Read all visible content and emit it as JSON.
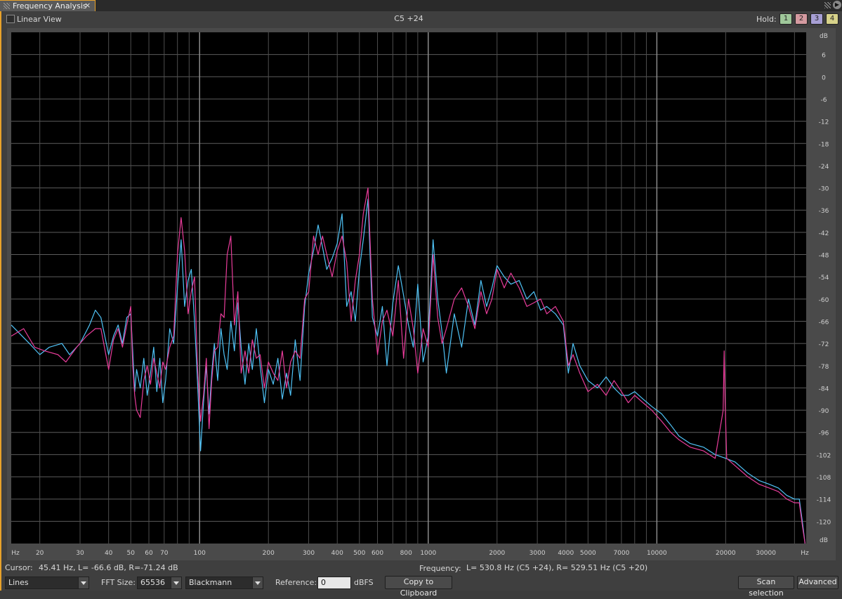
{
  "window": {
    "tab_title": "Frequency Analysis",
    "tab_close": "×"
  },
  "toolbar": {
    "linear_view_label": "Linear View",
    "linear_view_checked": false,
    "note_readout": "C5 +24",
    "hold_label": "Hold:",
    "hold_buttons": [
      {
        "label": "1",
        "color": "#9fc79a"
      },
      {
        "label": "2",
        "color": "#d49aa0"
      },
      {
        "label": "3",
        "color": "#a79fd4"
      },
      {
        "label": "4",
        "color": "#d7d28a"
      }
    ]
  },
  "chart_data": {
    "type": "line",
    "x_scale": "log",
    "xlim": [
      15,
      45000
    ],
    "ylim": [
      -126,
      12
    ],
    "x_unit": "Hz",
    "y_unit": "dB",
    "grid": true,
    "x_tick_labels": [
      {
        "f": 20,
        "label": "20"
      },
      {
        "f": 30,
        "label": "30"
      },
      {
        "f": 40,
        "label": "40"
      },
      {
        "f": 50,
        "label": "50"
      },
      {
        "f": 60,
        "label": "60"
      },
      {
        "f": 70,
        "label": "70"
      },
      {
        "f": 100,
        "label": "100"
      },
      {
        "f": 200,
        "label": "200"
      },
      {
        "f": 300,
        "label": "300"
      },
      {
        "f": 400,
        "label": "400"
      },
      {
        "f": 500,
        "label": "500"
      },
      {
        "f": 600,
        "label": "600"
      },
      {
        "f": 800,
        "label": "800"
      },
      {
        "f": 1000,
        "label": "1000"
      },
      {
        "f": 2000,
        "label": "2000"
      },
      {
        "f": 3000,
        "label": "3000"
      },
      {
        "f": 4000,
        "label": "4000"
      },
      {
        "f": 5000,
        "label": "5000"
      },
      {
        "f": 7000,
        "label": "7000"
      },
      {
        "f": 10000,
        "label": "10000"
      },
      {
        "f": 20000,
        "label": "20000"
      },
      {
        "f": 30000,
        "label": "30000"
      }
    ],
    "y_ticks": [
      6,
      0,
      -6,
      -12,
      -18,
      -24,
      -30,
      -36,
      -42,
      -48,
      -54,
      -60,
      -66,
      -72,
      -78,
      -84,
      -90,
      -96,
      -102,
      -108,
      -114,
      -120
    ],
    "series": [
      {
        "color": "#4fc3f7",
        "points": [
          [
            15,
            -67
          ],
          [
            18,
            -72
          ],
          [
            20,
            -75
          ],
          [
            22,
            -73
          ],
          [
            25,
            -72
          ],
          [
            27,
            -75
          ],
          [
            30,
            -72
          ],
          [
            33,
            -67
          ],
          [
            35,
            -63
          ],
          [
            37,
            -65
          ],
          [
            40,
            -75
          ],
          [
            42,
            -70
          ],
          [
            44,
            -67
          ],
          [
            46,
            -72
          ],
          [
            48,
            -65
          ],
          [
            50,
            -64
          ],
          [
            51,
            -74
          ],
          [
            52,
            -85
          ],
          [
            53,
            -79
          ],
          [
            55,
            -84
          ],
          [
            57,
            -76
          ],
          [
            59,
            -86
          ],
          [
            61,
            -80
          ],
          [
            63,
            -73
          ],
          [
            65,
            -85
          ],
          [
            67,
            -76
          ],
          [
            69,
            -88
          ],
          [
            71,
            -82
          ],
          [
            74,
            -68
          ],
          [
            77,
            -72
          ],
          [
            80,
            -57
          ],
          [
            83,
            -44
          ],
          [
            86,
            -62
          ],
          [
            89,
            -55
          ],
          [
            92,
            -52
          ],
          [
            95,
            -66
          ],
          [
            98,
            -83
          ],
          [
            101,
            -101
          ],
          [
            104,
            -88
          ],
          [
            107,
            -78
          ],
          [
            110,
            -91
          ],
          [
            113,
            -80
          ],
          [
            116,
            -72
          ],
          [
            120,
            -82
          ],
          [
            124,
            -68
          ],
          [
            128,
            -75
          ],
          [
            132,
            -79
          ],
          [
            137,
            -66
          ],
          [
            142,
            -74
          ],
          [
            147,
            -61
          ],
          [
            152,
            -73
          ],
          [
            158,
            -83
          ],
          [
            164,
            -72
          ],
          [
            170,
            -79
          ],
          [
            177,
            -68
          ],
          [
            184,
            -78
          ],
          [
            192,
            -88
          ],
          [
            200,
            -79
          ],
          [
            210,
            -83
          ],
          [
            220,
            -76
          ],
          [
            230,
            -87
          ],
          [
            240,
            -80
          ],
          [
            250,
            -86
          ],
          [
            262,
            -71
          ],
          [
            275,
            -82
          ],
          [
            288,
            -62
          ],
          [
            300,
            -53
          ],
          [
            315,
            -47
          ],
          [
            330,
            -40
          ],
          [
            345,
            -46
          ],
          [
            360,
            -52
          ],
          [
            380,
            -49
          ],
          [
            400,
            -45
          ],
          [
            420,
            -37
          ],
          [
            440,
            -62
          ],
          [
            460,
            -58
          ],
          [
            480,
            -66
          ],
          [
            500,
            -52
          ],
          [
            520,
            -44
          ],
          [
            545,
            -33
          ],
          [
            570,
            -65
          ],
          [
            600,
            -70
          ],
          [
            630,
            -62
          ],
          [
            660,
            -78
          ],
          [
            700,
            -61
          ],
          [
            740,
            -51
          ],
          [
            780,
            -59
          ],
          [
            820,
            -67
          ],
          [
            860,
            -73
          ],
          [
            900,
            -56
          ],
          [
            950,
            -77
          ],
          [
            1000,
            -70
          ],
          [
            1050,
            -44
          ],
          [
            1100,
            -60
          ],
          [
            1150,
            -69
          ],
          [
            1200,
            -80
          ],
          [
            1300,
            -64
          ],
          [
            1400,
            -73
          ],
          [
            1500,
            -60
          ],
          [
            1600,
            -67
          ],
          [
            1700,
            -55
          ],
          [
            1800,
            -62
          ],
          [
            1900,
            -57
          ],
          [
            2000,
            -51
          ],
          [
            2150,
            -54
          ],
          [
            2300,
            -56
          ],
          [
            2500,
            -55
          ],
          [
            2700,
            -60
          ],
          [
            2900,
            -58
          ],
          [
            3100,
            -63
          ],
          [
            3300,
            -62
          ],
          [
            3600,
            -64
          ],
          [
            3900,
            -67
          ],
          [
            4100,
            -80
          ],
          [
            4300,
            -72
          ],
          [
            4600,
            -78
          ],
          [
            5000,
            -82
          ],
          [
            5500,
            -84
          ],
          [
            6000,
            -81
          ],
          [
            6500,
            -84
          ],
          [
            7000,
            -86
          ],
          [
            7500,
            -86
          ],
          [
            8000,
            -85
          ],
          [
            8700,
            -87
          ],
          [
            9500,
            -89
          ],
          [
            10500,
            -91
          ],
          [
            11500,
            -94
          ],
          [
            12500,
            -97
          ],
          [
            14000,
            -99
          ],
          [
            16000,
            -100
          ],
          [
            18000,
            -102
          ],
          [
            20000,
            -103
          ],
          [
            22000,
            -104
          ],
          [
            25000,
            -107
          ],
          [
            28000,
            -109
          ],
          [
            31000,
            -110
          ],
          [
            34000,
            -111
          ],
          [
            37000,
            -113
          ],
          [
            40000,
            -114
          ],
          [
            42000,
            -114
          ],
          [
            43500,
            -121
          ],
          [
            44500,
            -126
          ]
        ]
      },
      {
        "color": "#e83c9a",
        "points": [
          [
            15,
            -70
          ],
          [
            17,
            -68
          ],
          [
            19,
            -73
          ],
          [
            21,
            -74
          ],
          [
            24,
            -75
          ],
          [
            26,
            -77
          ],
          [
            29,
            -73
          ],
          [
            32,
            -70
          ],
          [
            35,
            -68
          ],
          [
            37,
            -68
          ],
          [
            40,
            -79
          ],
          [
            42,
            -71
          ],
          [
            44,
            -68
          ],
          [
            46,
            -73
          ],
          [
            48,
            -67
          ],
          [
            50,
            -62
          ],
          [
            51,
            -78
          ],
          [
            52,
            -86
          ],
          [
            53,
            -90
          ],
          [
            55,
            -92
          ],
          [
            57,
            -82
          ],
          [
            59,
            -78
          ],
          [
            61,
            -83
          ],
          [
            63,
            -76
          ],
          [
            65,
            -80
          ],
          [
            67,
            -84
          ],
          [
            69,
            -77
          ],
          [
            71,
            -79
          ],
          [
            74,
            -73
          ],
          [
            77,
            -70
          ],
          [
            80,
            -48
          ],
          [
            83,
            -38
          ],
          [
            86,
            -47
          ],
          [
            89,
            -64
          ],
          [
            92,
            -58
          ],
          [
            95,
            -54
          ],
          [
            98,
            -79
          ],
          [
            101,
            -93
          ],
          [
            104,
            -86
          ],
          [
            107,
            -76
          ],
          [
            110,
            -95
          ],
          [
            113,
            -82
          ],
          [
            116,
            -74
          ],
          [
            120,
            -73
          ],
          [
            124,
            -64
          ],
          [
            128,
            -65
          ],
          [
            132,
            -48
          ],
          [
            137,
            -43
          ],
          [
            142,
            -67
          ],
          [
            147,
            -58
          ],
          [
            152,
            -80
          ],
          [
            158,
            -74
          ],
          [
            164,
            -80
          ],
          [
            170,
            -71
          ],
          [
            177,
            -76
          ],
          [
            184,
            -75
          ],
          [
            192,
            -84
          ],
          [
            200,
            -77
          ],
          [
            210,
            -80
          ],
          [
            220,
            -82
          ],
          [
            230,
            -74
          ],
          [
            240,
            -84
          ],
          [
            250,
            -77
          ],
          [
            262,
            -74
          ],
          [
            275,
            -76
          ],
          [
            288,
            -60
          ],
          [
            300,
            -58
          ],
          [
            315,
            -43
          ],
          [
            330,
            -48
          ],
          [
            345,
            -43
          ],
          [
            360,
            -48
          ],
          [
            380,
            -54
          ],
          [
            400,
            -47
          ],
          [
            420,
            -43
          ],
          [
            440,
            -50
          ],
          [
            460,
            -66
          ],
          [
            480,
            -55
          ],
          [
            500,
            -48
          ],
          [
            520,
            -37
          ],
          [
            545,
            -30
          ],
          [
            570,
            -60
          ],
          [
            600,
            -75
          ],
          [
            630,
            -66
          ],
          [
            660,
            -63
          ],
          [
            700,
            -70
          ],
          [
            740,
            -55
          ],
          [
            780,
            -76
          ],
          [
            820,
            -60
          ],
          [
            860,
            -68
          ],
          [
            900,
            -80
          ],
          [
            950,
            -68
          ],
          [
            1000,
            -73
          ],
          [
            1050,
            -48
          ],
          [
            1100,
            -65
          ],
          [
            1150,
            -72
          ],
          [
            1200,
            -68
          ],
          [
            1300,
            -60
          ],
          [
            1400,
            -57
          ],
          [
            1500,
            -62
          ],
          [
            1600,
            -68
          ],
          [
            1700,
            -58
          ],
          [
            1800,
            -64
          ],
          [
            1900,
            -60
          ],
          [
            2000,
            -52
          ],
          [
            2150,
            -57
          ],
          [
            2300,
            -53
          ],
          [
            2500,
            -57
          ],
          [
            2700,
            -62
          ],
          [
            2900,
            -61
          ],
          [
            3100,
            -60
          ],
          [
            3300,
            -64
          ],
          [
            3600,
            -62
          ],
          [
            3900,
            -66
          ],
          [
            4100,
            -78
          ],
          [
            4300,
            -75
          ],
          [
            4600,
            -80
          ],
          [
            5000,
            -85
          ],
          [
            5500,
            -83
          ],
          [
            6000,
            -86
          ],
          [
            6500,
            -82
          ],
          [
            7000,
            -85
          ],
          [
            7500,
            -88
          ],
          [
            8000,
            -86
          ],
          [
            8700,
            -88
          ],
          [
            9500,
            -90
          ],
          [
            10500,
            -93
          ],
          [
            11500,
            -96
          ],
          [
            12500,
            -98
          ],
          [
            14000,
            -100
          ],
          [
            16000,
            -101
          ],
          [
            18000,
            -103
          ],
          [
            19500,
            -90
          ],
          [
            19700,
            -74
          ],
          [
            19900,
            -88
          ],
          [
            20200,
            -103
          ],
          [
            22000,
            -105
          ],
          [
            25000,
            -108
          ],
          [
            28000,
            -110
          ],
          [
            31000,
            -111
          ],
          [
            34000,
            -112
          ],
          [
            37000,
            -114
          ],
          [
            40000,
            -115
          ],
          [
            42000,
            -115
          ],
          [
            43500,
            -122
          ],
          [
            44500,
            -126
          ]
        ]
      }
    ]
  },
  "status": {
    "cursor_label": "Cursor:",
    "cursor_value": "45.41 Hz, L= -66.6 dB, R=-71.24 dB",
    "frequency_label": "Frequency:",
    "frequency_value": "L=  530.8 Hz (C5 +24), R= 529.51 Hz (C5 +20)"
  },
  "controls": {
    "display_mode": "Lines",
    "fft_size_label": "FFT Size:",
    "fft_size": "65536",
    "window_fn": "Blackmann",
    "reference_label": "Reference:",
    "reference_value": "0",
    "reference_unit": "dBFS",
    "copy_button": "Copy to Clipboard",
    "scan_button": "Scan selection",
    "advanced_button": "Advanced"
  }
}
